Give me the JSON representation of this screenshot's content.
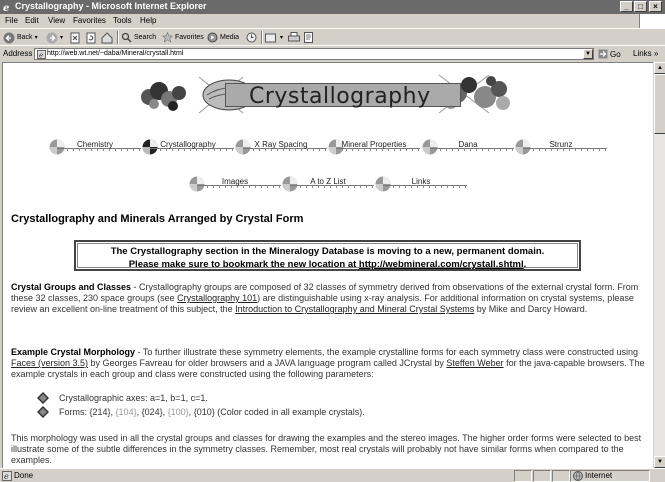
{
  "window": {
    "title": "Crystallography - Microsoft Internet Explorer",
    "buttons": [
      "_",
      "□",
      "×"
    ]
  },
  "menu": {
    "items": [
      "File",
      "Edit",
      "View",
      "Favorites",
      "Tools",
      "Help"
    ]
  },
  "toolbar": {
    "back_label": "Back",
    "search_label": "Search",
    "favorites_label": "Favorites",
    "media_label": "Media"
  },
  "address": {
    "label": "Address",
    "url": "http://web.wt.net/~daba/Mineral/crystall.html",
    "go_label": "Go",
    "links_label": "Links"
  },
  "page": {
    "banner_title": "Crystallography",
    "nav_row1": [
      "Chemistry",
      "Crystallography",
      "X Ray Spacing",
      "Mineral Properties",
      "Dana",
      "Strunz"
    ],
    "nav_row2": [
      "Images",
      "A to Z List",
      "Links"
    ],
    "heading": "Crystallography and Minerals Arranged by Crystal Form",
    "notice": {
      "line1": "The Crystallography section in the Mineralogy Database is moving to a new, permanent domain.",
      "line2_prefix": "Please make sure to bookmark the new location at ",
      "line2_link": "http://webmineral.com/crystall.shtml",
      "line2_suffix": "."
    },
    "groups_para": {
      "title": "Crystal Groups and Classes",
      "t1": " - Crystallography groups are composed of 32 classes of symmetry derived from observations of the external crystal form.  From these 32 classes, 230 space groups (see ",
      "link1": "Crystallography 101",
      "t2": ") are distinguishable using x-ray analysis.  For additional information on crystal systems, please review an excellent on-line treatment of this subject, the ",
      "link2": "Introduction to Crystallography and Mineral Crystal Systems",
      "t3": " by Mike and Darcy Howard."
    },
    "morph_para": {
      "title": "Example Crystal Morphology",
      "t1": " - To further illustrate these symmetry elements, the example crystalline forms for each symmetry class were constructed using ",
      "link1": "Faces (version 3.5)",
      "t2": " by Georges Favreau for older browsers and a JAVA language program called JCrystal by ",
      "link2": "Steffen Weber",
      "t3": " for the java-capable browsers. The example crystals in each group and class were constructed using the following parameters:"
    },
    "bullets": {
      "axes": "Crystallographic axes: a=1, b=1, c=1.",
      "forms_prefix": "Forms: ",
      "f1": "{214}",
      "sep": ", ",
      "f2": "{104}",
      "f3": "{024}",
      "f4": "{100}",
      "f5": "{010}",
      "forms_suffix": " (Color coded in all example crystals)."
    },
    "closing_para": "This morphology was used in all the crystal groups and classes for drawing the examples and the stereo images. The higher order forms were selected to best illustrate some of the subtle differences in the symmetry classes.  Remember, most real crystals will probably not have similar forms when compared to the examples."
  },
  "status": {
    "text": "Done",
    "zone": "Internet"
  }
}
